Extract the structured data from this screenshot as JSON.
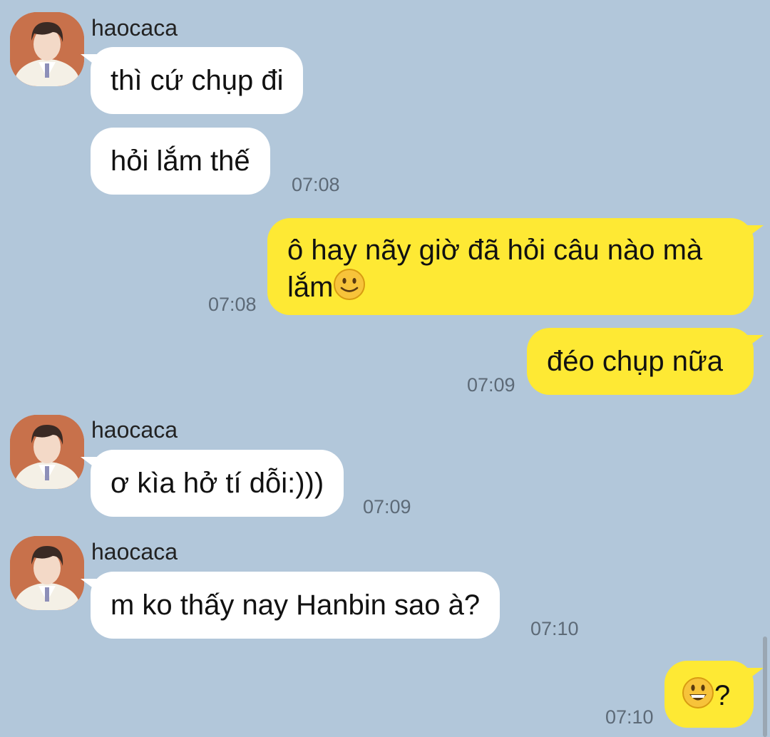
{
  "conversation": {
    "contact_name": "haocaca",
    "messages": [
      {
        "id": "m1",
        "direction": "incoming",
        "sender": "haocaca",
        "text": "thì cứ chụp đi",
        "time": ""
      },
      {
        "id": "m2",
        "direction": "incoming",
        "sender": "",
        "text": "hỏi lắm thế",
        "time": "07:08"
      },
      {
        "id": "m3",
        "direction": "outgoing",
        "text_line1": "ô hay nãy giờ đã hỏi câu nào mà",
        "text_line2": "lắm",
        "emoji": "slightly-smiling-face",
        "time": "07:08"
      },
      {
        "id": "m4",
        "direction": "outgoing",
        "text": "đéo chụp nữa",
        "time": "07:09"
      },
      {
        "id": "m5",
        "direction": "incoming",
        "sender": "haocaca",
        "text": "ơ kìa hở tí dỗi:)))",
        "time": "07:09"
      },
      {
        "id": "m6",
        "direction": "incoming",
        "sender": "haocaca",
        "text": "m ko thấy nay Hanbin sao à?",
        "time": "07:10"
      },
      {
        "id": "m7",
        "direction": "outgoing",
        "emoji": "grinning-face",
        "text": "?",
        "time": "07:10"
      }
    ]
  },
  "colors": {
    "background": "#b2c7da",
    "incoming_bubble": "#ffffff",
    "outgoing_bubble": "#fee934",
    "timestamp": "#5d6a77"
  }
}
